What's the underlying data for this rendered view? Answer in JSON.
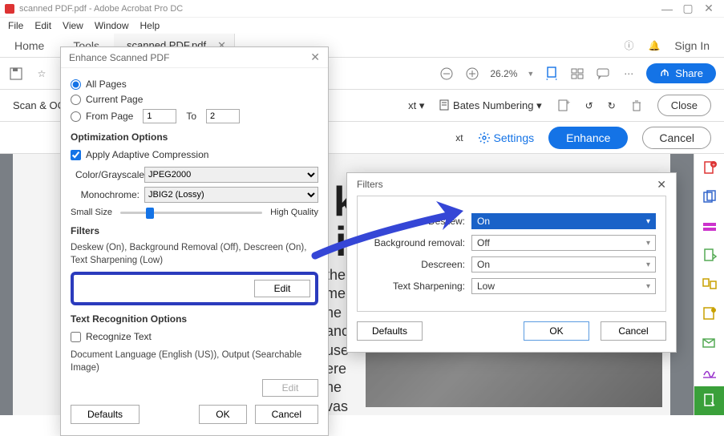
{
  "window": {
    "title": "scanned PDF.pdf - Adobe Acrobat Pro DC"
  },
  "menubar": [
    "File",
    "Edit",
    "View",
    "Window",
    "Help"
  ],
  "tabs": {
    "home": "Home",
    "tools": "Tools",
    "doc": "scanned PDF.pdf",
    "signin": "Sign In"
  },
  "toolbar": {
    "zoom": "26.2%",
    "share": "Share",
    "scan_ocr": "Scan & OCR",
    "bates": "Bates Numbering",
    "close": "Close",
    "settings": "Settings",
    "enhance": "Enhance",
    "cancel": "Cancel",
    "xt1": "xt",
    "xt2": "xt"
  },
  "dialog_enhance": {
    "title": "Enhance Scanned PDF",
    "radio_all": "All Pages",
    "radio_current": "Current Page",
    "radio_from": "From Page",
    "from_val": "1",
    "to_lbl": "To",
    "to_val": "2",
    "opt_title": "Optimization Options",
    "adaptive": "Apply Adaptive Compression",
    "color_lbl": "Color/Grayscale:",
    "color_val": "JPEG2000",
    "mono_lbl": "Monochrome:",
    "mono_val": "JBIG2 (Lossy)",
    "small": "Small Size",
    "high": "High Quality",
    "filters_title": "Filters",
    "filters_summary": "Deskew (On), Background Removal (Off), Descreen (On), Text Sharpening (Low)",
    "edit": "Edit",
    "textrec_title": "Text Recognition Options",
    "recognize": "Recognize Text",
    "doclang": "Document Language (English (US)), Output (Searchable Image)",
    "edit2": "Edit",
    "defaults": "Defaults",
    "ok": "OK",
    "cancel": "Cancel"
  },
  "dialog_filters": {
    "title": "Filters",
    "rows": {
      "deskew_lbl": "Deskew:",
      "deskew_val": "On",
      "bg_lbl": "Background removal:",
      "bg_val": "Off",
      "descreen_lbl": "Descreen:",
      "descreen_val": "On",
      "sharpen_lbl": "Text Sharpening:",
      "sharpen_val": "Low"
    },
    "defaults": "Defaults",
    "ok": "OK",
    "cancel": "Cancel"
  },
  "doc_words": {
    "a": "ki",
    "b": "in",
    "para": "the\nme\nhe\nance\nuse\nere\nhe\nvas"
  }
}
